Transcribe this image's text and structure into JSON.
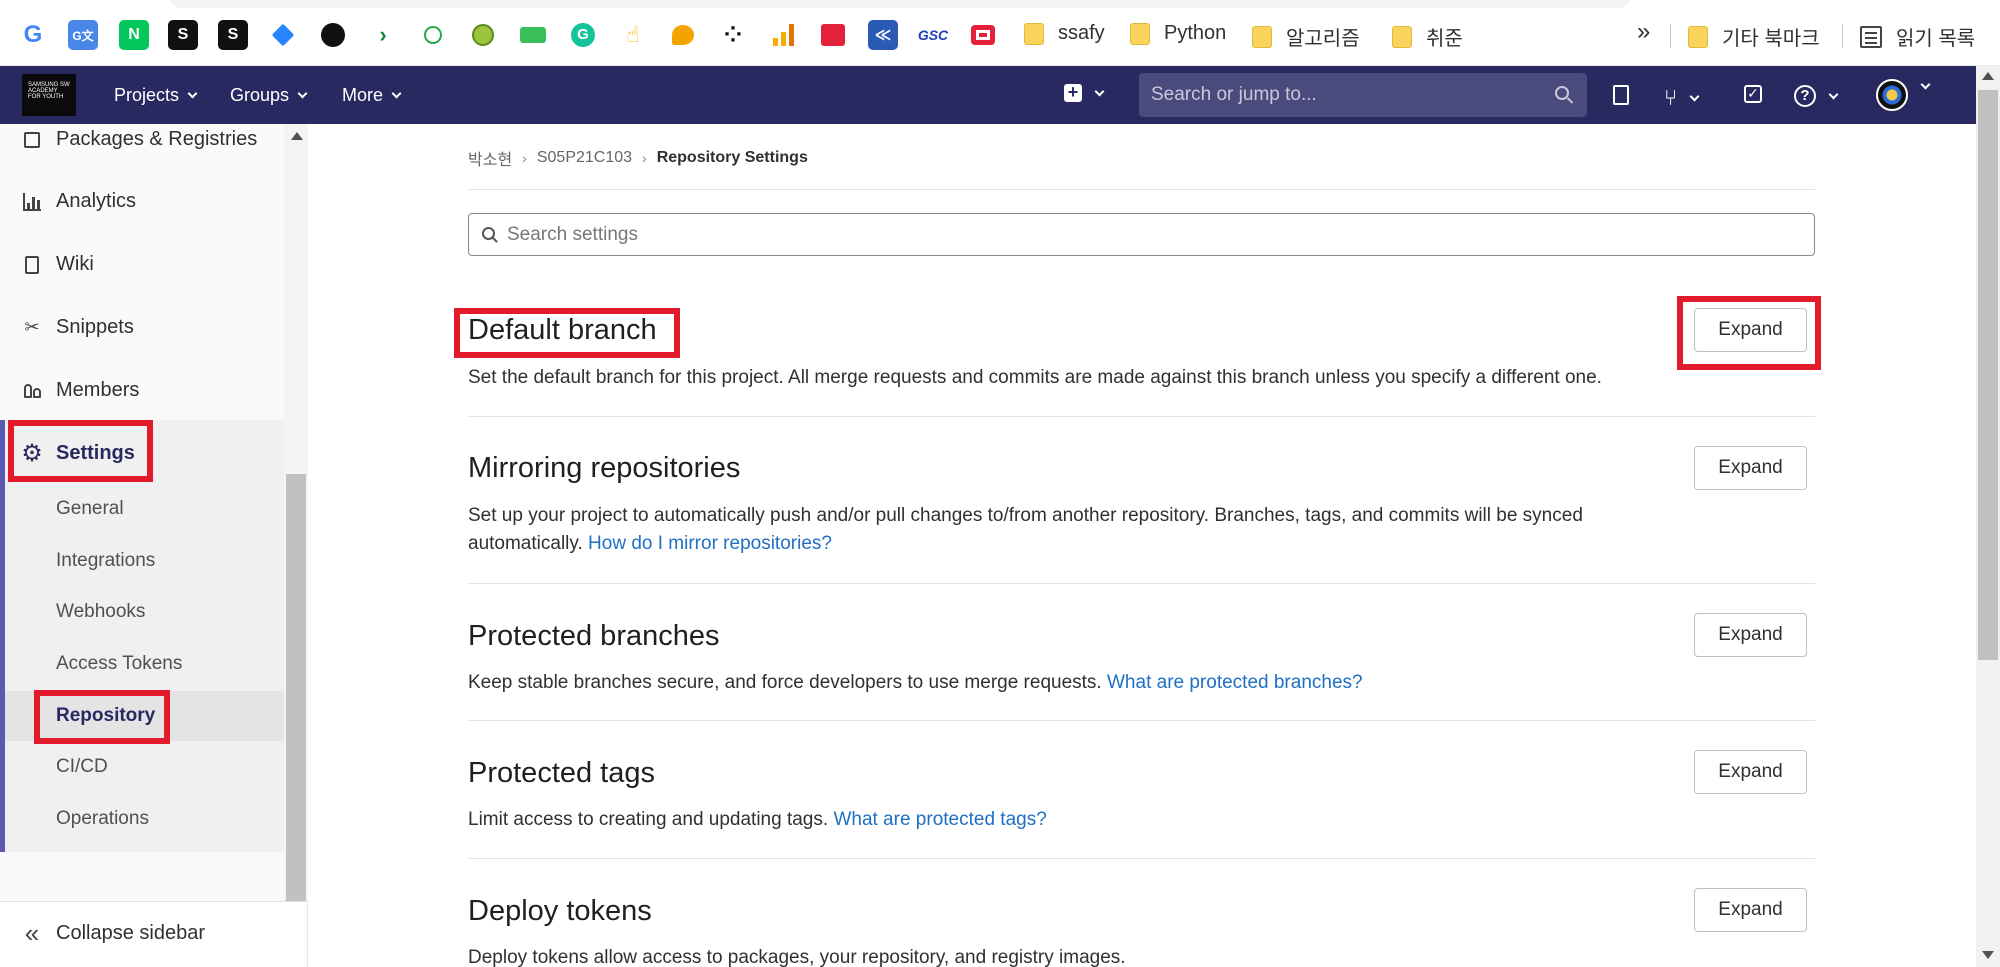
{
  "bookmarks": {
    "icons": [
      "google-icon",
      "google-translate-icon",
      "naver-icon",
      "notion-icon",
      "notion-icon",
      "jira-icon",
      "github-icon",
      "bookmark-icon",
      "bookmark-icon",
      "bookmark-icon",
      "bookmark-icon",
      "grammarly-icon",
      "bookmark-icon",
      "bookmark-icon",
      "bookmark-icon",
      "analytics-icon",
      "bookmark-icon",
      "bookmark-icon",
      "bookmark-icon",
      "bookmark-icon"
    ],
    "icon_glyphs": {
      "google": "G",
      "naver": "N",
      "notion": "S",
      "gsc": "GSC",
      "grammarly": "G"
    },
    "folders": [
      "ssafy",
      "Python",
      "알고리즘",
      "취준"
    ],
    "more": "»",
    "other_bookmarks": "기타 북마크",
    "reading_list": "읽기 목록"
  },
  "navbar": {
    "logo_text": "SAMSUNG SW ACADEMY FOR YOUTH",
    "menus": [
      "Projects",
      "Groups",
      "More"
    ],
    "search_placeholder": "Search or jump to..."
  },
  "sidebar": {
    "items": [
      {
        "label": "Packages & Registries",
        "icon": "package-icon"
      },
      {
        "label": "Analytics",
        "icon": "chart-icon"
      },
      {
        "label": "Wiki",
        "icon": "book-icon"
      },
      {
        "label": "Snippets",
        "icon": "scissors-icon"
      },
      {
        "label": "Members",
        "icon": "users-icon"
      }
    ],
    "settings_label": "Settings",
    "settings_sub": [
      "General",
      "Integrations",
      "Webhooks",
      "Access Tokens",
      "Repository",
      "CI/CD",
      "Operations"
    ],
    "collapse_label": "Collapse sidebar"
  },
  "breadcrumb": [
    "박소현",
    "S05P21C103",
    "Repository Settings"
  ],
  "settings_search_placeholder": "Search settings",
  "sections": [
    {
      "title": "Default branch",
      "desc": "Set the default branch for this project. All merge requests and commits are made against this branch unless you specify a different one.",
      "link": "",
      "button": "Expand"
    },
    {
      "title": "Mirroring repositories",
      "desc": "Set up your project to automatically push and/or pull changes to/from another repository. Branches, tags, and commits will be synced automatically.",
      "link": "How do I mirror repositories?",
      "button": "Expand"
    },
    {
      "title": "Protected branches",
      "desc": "Keep stable branches secure, and force developers to use merge requests.",
      "link": "What are protected branches?",
      "button": "Expand"
    },
    {
      "title": "Protected tags",
      "desc": "Limit access to creating and updating tags.",
      "link": "What are protected tags?",
      "button": "Expand"
    },
    {
      "title": "Deploy tokens",
      "desc": "Deploy tokens allow access to packages, your repository, and registry images.",
      "link": "",
      "button": "Expand"
    }
  ],
  "colors": {
    "navbar": "#292961",
    "highlight": "#e21a2b",
    "link": "#1f6fc5",
    "sidebar_accent": "#5a5ab5"
  }
}
